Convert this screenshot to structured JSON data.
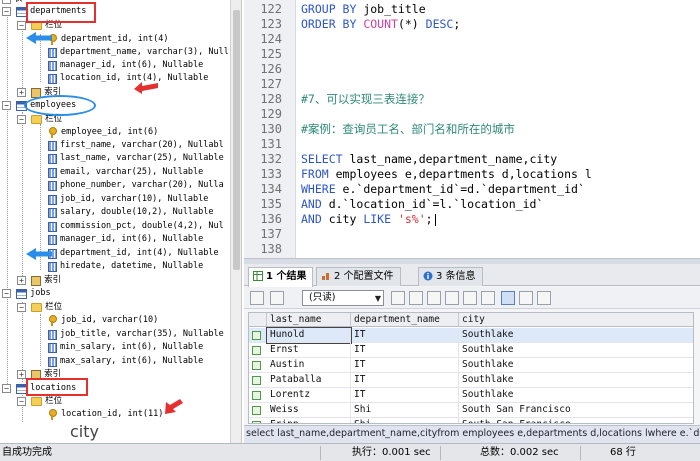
{
  "tree": {
    "top_clip": "表",
    "departments": {
      "name": "departments",
      "columns_folder": "栏位",
      "columns": [
        "department_id, int(4)",
        "department_name, varchar(3), Null",
        "manager_id, int(6), Nullable",
        "location_id, int(4), Nullable"
      ],
      "index_folder": "索引"
    },
    "employees": {
      "name": "employees",
      "columns_folder": "栏位",
      "columns": [
        "employee_id, int(6)",
        "first_name, varchar(20), Nullabl",
        "last_name, varchar(25), Nullable",
        "email, varchar(25), Nullable",
        "phone_number, varchar(20), Nulla",
        "job_id, varchar(10), Nullable",
        "salary, double(10,2), Nullable",
        "commission_pct, double(4,2), Nul",
        "manager_id, int(6), Nullable",
        "department_id, int(4), Nullable",
        "hiredate, datetime, Nullable"
      ],
      "index_folder": "索引"
    },
    "jobs": {
      "name": "jobs",
      "columns_folder": "栏位",
      "columns": [
        "job_id, varchar(10)",
        "job_title, varchar(35), Nullable",
        "min_salary, int(6), Nullable",
        "max_salary, int(6), Nullable"
      ],
      "index_folder": "索引"
    },
    "locations": {
      "name": "locations",
      "columns_folder": "栏位",
      "columns": [
        "location_id, int(11)"
      ]
    }
  },
  "editor": {
    "lines": [
      {
        "num": "122",
        "parts": [
          [
            "kw",
            "GROUP BY "
          ],
          [
            "",
            "job_title"
          ]
        ]
      },
      {
        "num": "123",
        "parts": [
          [
            "kw",
            "ORDER BY "
          ],
          [
            "fn",
            "COUNT"
          ],
          [
            "",
            "(*) "
          ],
          [
            "kw",
            "DESC"
          ],
          [
            "",
            ";"
          ]
        ]
      },
      {
        "num": "124",
        "parts": []
      },
      {
        "num": "125",
        "parts": []
      },
      {
        "num": "126",
        "parts": []
      },
      {
        "num": "127",
        "parts": []
      },
      {
        "num": "128",
        "parts": [
          [
            "cm",
            "#7、可以实现三表连接？"
          ]
        ]
      },
      {
        "num": "129",
        "parts": []
      },
      {
        "num": "130",
        "parts": [
          [
            "cm",
            "#案例：查询员工名、部门名和所在的城市"
          ]
        ]
      },
      {
        "num": "131",
        "parts": []
      },
      {
        "num": "132",
        "parts": [
          [
            "kw",
            "SELECT "
          ],
          [
            "",
            "last_name,department_name,city"
          ]
        ]
      },
      {
        "num": "133",
        "parts": [
          [
            "kw",
            "FROM "
          ],
          [
            "",
            "employees e,departments d,locations l"
          ]
        ]
      },
      {
        "num": "134",
        "parts": [
          [
            "kw",
            "WHERE "
          ],
          [
            "",
            "e.`department_id`=d.`department_id`"
          ]
        ]
      },
      {
        "num": "135",
        "parts": [
          [
            "kw",
            "AND "
          ],
          [
            "",
            "d.`location_id`=l.`location_id`"
          ]
        ]
      },
      {
        "num": "136",
        "parts": [
          [
            "kw",
            "AND "
          ],
          [
            "",
            "city "
          ],
          [
            "kw",
            "LIKE "
          ],
          [
            "st",
            "'s%'"
          ],
          [
            "",
            ";"
          ]
        ]
      },
      {
        "num": "137",
        "parts": []
      },
      {
        "num": "138",
        "parts": []
      }
    ]
  },
  "results": {
    "tabs": [
      {
        "num": "1",
        "label": "个结果"
      },
      {
        "num": "2",
        "label": "个配置文件"
      },
      {
        "num": "3",
        "label": "条信息"
      }
    ],
    "readonly_select": "(只读)",
    "columns": [
      "last_name",
      "department_name",
      "city"
    ],
    "rows": [
      [
        "Hunold",
        "IT",
        "Southlake"
      ],
      [
        "Ernst",
        "IT",
        "Southlake"
      ],
      [
        "Austin",
        "IT",
        "Southlake"
      ],
      [
        "Pataballa",
        "IT",
        "Southlake"
      ],
      [
        "Lorentz",
        "IT",
        "Southlake"
      ],
      [
        "Weiss",
        "Shi",
        "South San Francisco"
      ],
      [
        "Fripp",
        "Shi",
        "South San Francisco"
      ]
    ],
    "sql_preview": "select last_name,department_name,cityfrom employees e,departments d,locations lwhere e.`de"
  },
  "status": {
    "left": "自成功完成",
    "exec": "执行：0.001 sec",
    "total": "总数：0.002 sec",
    "rows": "68 行"
  },
  "overlay_city": "city",
  "colors": {
    "keyword": "#2c55c8",
    "function": "#d040a0",
    "comment": "#2e8a78",
    "string": "#d03030",
    "annotation_red": "#e53030",
    "annotation_blue": "#2a8de8"
  }
}
